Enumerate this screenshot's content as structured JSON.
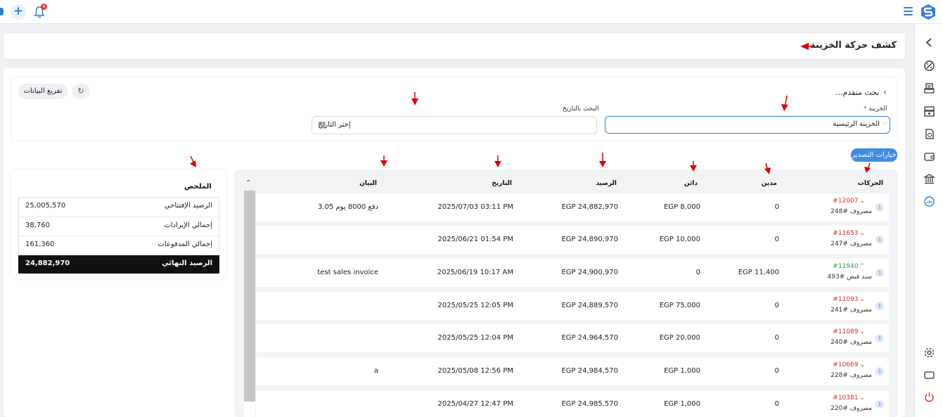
{
  "topbar": {
    "notification_count": "6"
  },
  "page": {
    "title": "كشف حركة الخزينة"
  },
  "filters": {
    "advanced_search_label": "بحث متقدم...",
    "dump_data_label": "تفريغ البيانات",
    "treasury_label": "الخزينة",
    "treasury_required_mark": "*",
    "treasury_value": "الخزينة الرئيسية",
    "date_label": "البحث بالتاريخ",
    "date_placeholder": "إختر التاريخ"
  },
  "export": {
    "label": "خيارات التصدير"
  },
  "summary": {
    "title": "الملخص",
    "rows": [
      {
        "label": "الرصيد الإفتتاحي",
        "value": "25,005,570"
      },
      {
        "label": "إجمالي الإيرادات",
        "value": "38,760"
      },
      {
        "label": "إجمالي المدفوعات",
        "value": "161,360"
      }
    ],
    "final": {
      "label": "الرصيد النهائي",
      "value": "24,882,970"
    }
  },
  "table": {
    "headers": {
      "movements": "الحركات",
      "debit": "مدين",
      "credit": "دائن",
      "balance": "الرصيد",
      "date": "التاريخ",
      "statement": "البيان"
    },
    "rows": [
      {
        "badge": "1",
        "number": "#12007",
        "direction": "down",
        "type": "مصروف #248",
        "debit": "0",
        "credit": "EGP 8,000",
        "balance": "EGP 24,882,970",
        "date": "2025/07/03 03:11 PM",
        "statement": "دفع 8000 يوم 3.05"
      },
      {
        "badge": "1",
        "number": "#11653",
        "direction": "down",
        "type": "مصروف #247",
        "debit": "0",
        "credit": "EGP 10,000",
        "balance": "EGP 24,890,970",
        "date": "2025/06/21 01:54 PM",
        "statement": ""
      },
      {
        "badge": "1",
        "number": "#11940",
        "direction": "up",
        "type": "سند قبض #493",
        "debit": "EGP 11,400",
        "credit": "0",
        "balance": "EGP 24,900,970",
        "date": "2025/06/19 10:17 AM",
        "statement": "test sales invoice"
      },
      {
        "badge": "1",
        "number": "#11093",
        "direction": "down",
        "type": "مصروف #241",
        "debit": "0",
        "credit": "EGP 75,000",
        "balance": "EGP 24,889,570",
        "date": "2025/05/25 12:05 PM",
        "statement": ""
      },
      {
        "badge": "1",
        "number": "#11089",
        "direction": "down",
        "type": "مصروف #240",
        "debit": "0",
        "credit": "EGP 20,000",
        "balance": "EGP 24,964,570",
        "date": "2025/05/25 12:04 PM",
        "statement": ""
      },
      {
        "badge": "1",
        "number": "#10669",
        "direction": "down",
        "type": "مصروف #228",
        "debit": "0",
        "credit": "EGP 1,000",
        "balance": "EGP 24,984,570",
        "date": "2025/05/08 12:56 PM",
        "statement": "a"
      },
      {
        "badge": "1",
        "number": "#10381",
        "direction": "down",
        "type": "مصروف #220",
        "debit": "0",
        "credit": "EGP 1,000",
        "balance": "EGP 24,985,570",
        "date": "2025/04/27 12:47 PM",
        "statement": ""
      }
    ]
  },
  "colors": {
    "accent": "#2f7fd8",
    "debit_red": "#d32f2f",
    "credit_green": "#2e9a4a",
    "annotation_arrow": "#e00000"
  },
  "icons": {
    "sidebar": [
      "chevron-left-icon",
      "coupon-icon",
      "printer-receipt-icon",
      "cash-register-icon",
      "document-money-icon",
      "wallet-icon",
      "bank-icon",
      "chart-active-icon",
      "settings-icon",
      "display-icon",
      "power-icon"
    ]
  }
}
